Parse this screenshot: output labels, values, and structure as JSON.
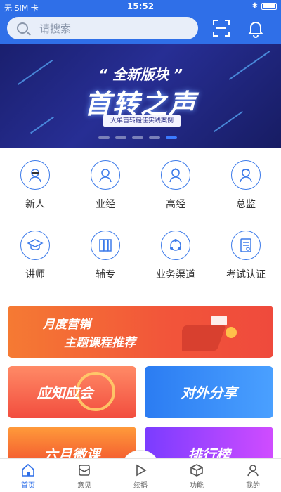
{
  "status": {
    "carrier": "无 SIM 卡",
    "time": "15:52"
  },
  "header": {
    "search_placeholder": "请搜索",
    "icons": [
      "scan-icon",
      "bell-icon"
    ]
  },
  "banner": {
    "tag": "“ 全新版块 ”",
    "title": "首转之声",
    "subtitle": "大单首转最佳实践案例",
    "slides": 5,
    "active_slide": 4
  },
  "grid": {
    "row1": [
      {
        "label": "新人",
        "icon": "newcomer-icon"
      },
      {
        "label": "业经",
        "icon": "business-manager-icon"
      },
      {
        "label": "高经",
        "icon": "senior-manager-icon"
      },
      {
        "label": "总监",
        "icon": "director-icon"
      }
    ],
    "row2": [
      {
        "label": "讲师",
        "icon": "lecturer-icon"
      },
      {
        "label": "辅专",
        "icon": "assistant-specialist-icon"
      },
      {
        "label": "业务渠道",
        "icon": "business-channel-icon"
      },
      {
        "label": "考试认证",
        "icon": "exam-certificate-icon"
      }
    ]
  },
  "cards": {
    "monthly_line1": "月度营销",
    "monthly_line2": "主题课程推荐",
    "must_know": "应知应会",
    "external_share": "对外分享",
    "june_course": "六月微课",
    "ranking": "排行榜"
  },
  "tabbar": [
    {
      "label": "首页",
      "icon": "home-icon",
      "active": true
    },
    {
      "label": "意见",
      "icon": "feedback-icon",
      "active": false
    },
    {
      "label": "续播",
      "icon": "play-icon",
      "active": false
    },
    {
      "label": "功能",
      "icon": "box-icon",
      "active": false
    },
    {
      "label": "我的",
      "icon": "profile-icon",
      "active": false
    }
  ],
  "colors": {
    "primary": "#2f6fe8",
    "orange": "#f2553a",
    "blue_card": "#2b7cf2",
    "purple_card": "#a44cff"
  }
}
